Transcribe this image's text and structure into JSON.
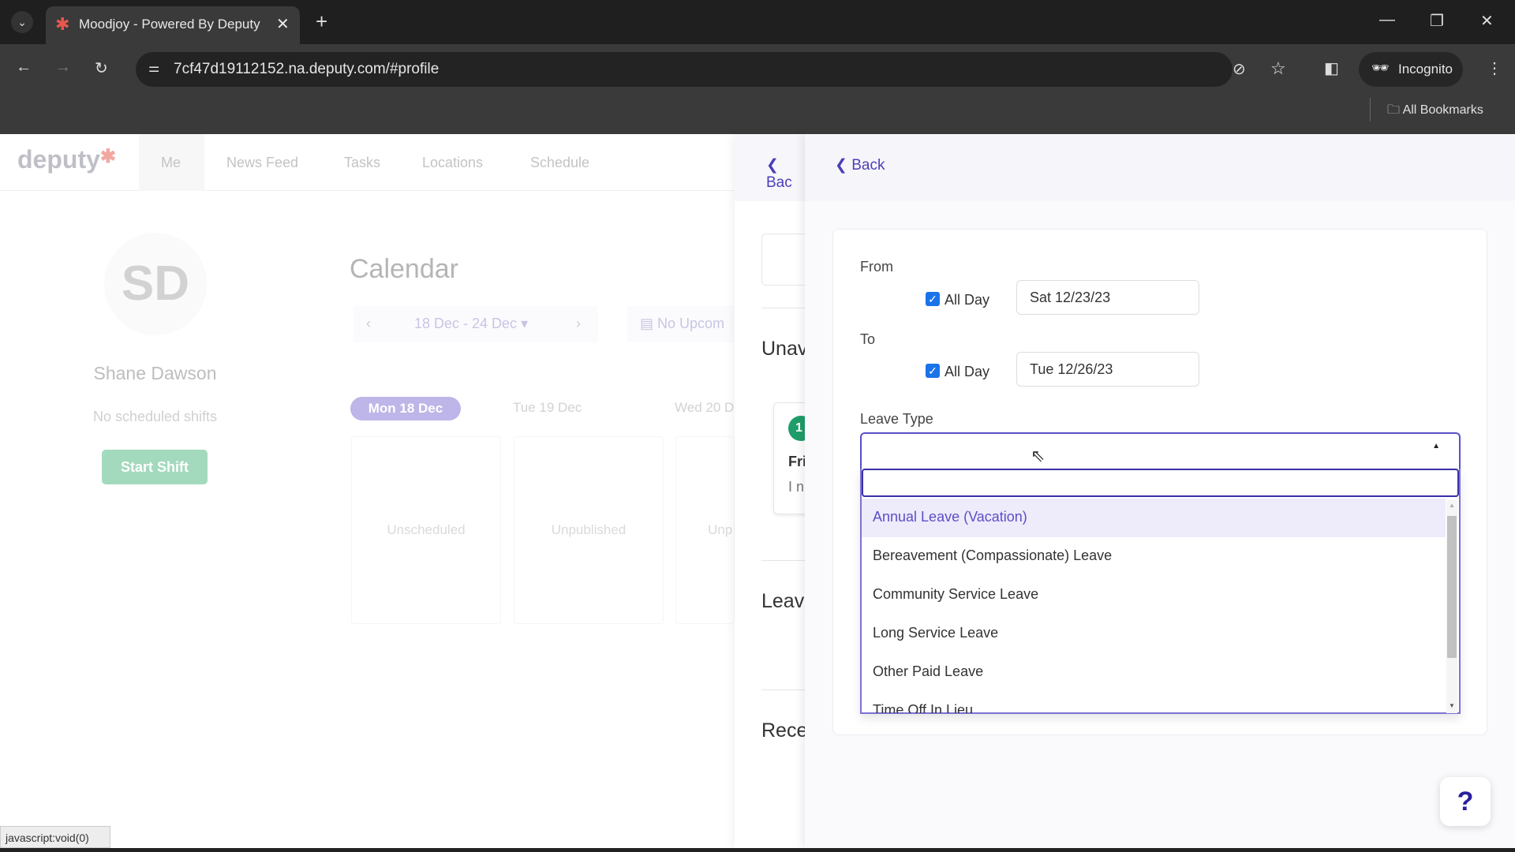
{
  "browser": {
    "tab_title": "Moodjoy - Powered By Deputy",
    "url": "7cf47d19112152.na.deputy.com/#profile",
    "incognito_label": "Incognito",
    "bookmarks_label": "All Bookmarks",
    "status_bar": "javascript:void(0)"
  },
  "nav": {
    "logo": "deputy",
    "items": [
      "Me",
      "News Feed",
      "Tasks",
      "Locations",
      "Schedule"
    ],
    "active": "Me"
  },
  "profile": {
    "initials": "SD",
    "name": "Shane Dawson",
    "shifts": "No scheduled shifts",
    "start_shift": "Start Shift"
  },
  "calendar": {
    "title": "Calendar",
    "range": "18 Dec - 24 Dec",
    "upcoming": "No Upcom",
    "days": [
      "Mon 18 Dec",
      "Tue 19 Dec",
      "Wed 20 D"
    ],
    "columns": [
      "Unscheduled",
      "Unpublished",
      "Unp"
    ]
  },
  "middle": {
    "back": "Bac",
    "unavailability": "Unav",
    "badge": "1",
    "day": "Fri",
    "info": "I n",
    "leave": "Leave",
    "recent": "Rece"
  },
  "form": {
    "back": "Back",
    "from_label": "From",
    "to_label": "To",
    "all_day": "All Day",
    "from_all_day": true,
    "to_all_day": true,
    "from_date": "Sat 12/23/23",
    "to_date": "Tue 12/26/23",
    "leave_type_label": "Leave Type",
    "search_value": "",
    "options": [
      "Annual Leave (Vacation)",
      "Bereavement (Compassionate) Leave",
      "Community Service Leave",
      "Long Service Leave",
      "Other Paid Leave",
      "Time Off In Lieu"
    ],
    "highlighted": "Annual Leave (Vacation)",
    "help": "?"
  },
  "colors": {
    "accent": "#4b3fb8",
    "highlight": "#eeebfb",
    "checkbox": "#1a73e8",
    "green": "#1e9e6a"
  }
}
